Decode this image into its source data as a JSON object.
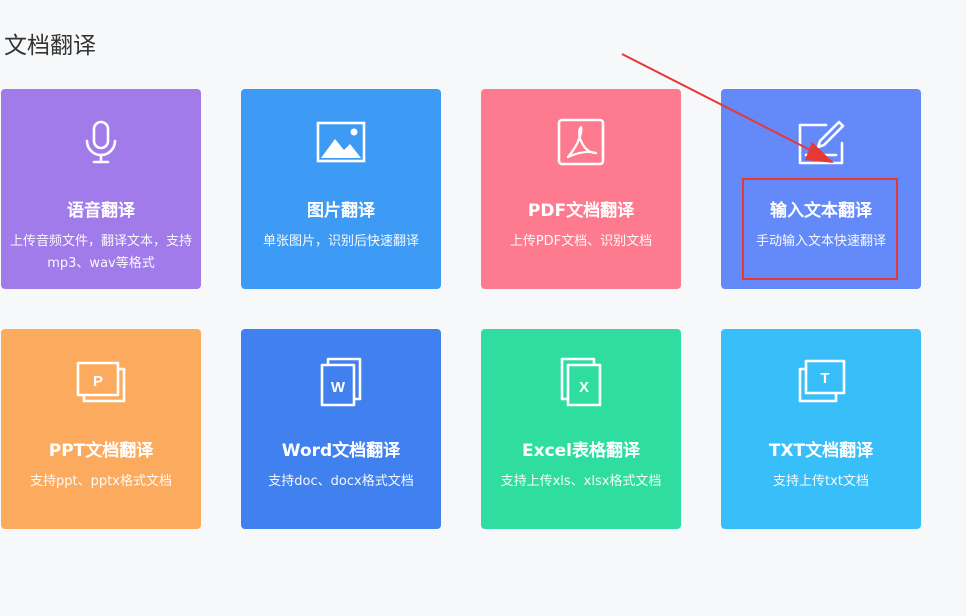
{
  "page": {
    "title": "文档翻译"
  },
  "cards": [
    {
      "title": "语音翻译",
      "desc": "上传音频文件，翻译文本，支持mp3、wav等格式",
      "icon": "microphone-icon",
      "color": "#a17bea"
    },
    {
      "title": "图片翻译",
      "desc": "单张图片，识别后快速翻译",
      "icon": "image-icon",
      "color": "#3d9af5"
    },
    {
      "title": "PDF文档翻译",
      "desc": "上传PDF文档、识别文档",
      "icon": "pdf-icon",
      "color": "#fe7b8f"
    },
    {
      "title": "输入文本翻译",
      "desc": "手动输入文本快速翻译",
      "icon": "edit-text-icon",
      "color": "#6489f9"
    },
    {
      "title": "PPT文档翻译",
      "desc": "支持ppt、pptx格式文档",
      "icon": "ppt-icon",
      "color": "#fcab5e"
    },
    {
      "title": "Word文档翻译",
      "desc": "支持doc、docx格式文档",
      "icon": "word-icon",
      "color": "#4080ef"
    },
    {
      "title": "Excel表格翻译",
      "desc": "支持上传xls、xlsx格式文档",
      "icon": "excel-icon",
      "color": "#2edd9f"
    },
    {
      "title": "TXT文档翻译",
      "desc": "支持上传txt文档",
      "icon": "txt-icon",
      "color": "#38bffa"
    }
  ],
  "annotation": {
    "highlight_color": "#e53935"
  }
}
